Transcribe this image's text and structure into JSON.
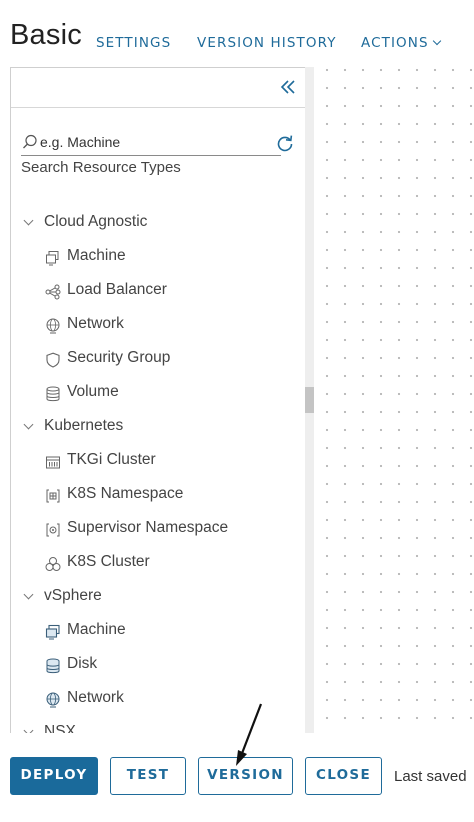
{
  "header": {
    "title": "Basic",
    "nav": {
      "settings": "SETTINGS",
      "version_history": "VERSION HISTORY",
      "actions": "ACTIONS"
    }
  },
  "sidebar": {
    "collapse_icon": "double-chevron-left-icon",
    "search": {
      "placeholder": "e.g. Machine",
      "label": "Search Resource Types"
    },
    "refresh_icon": "refresh-icon",
    "categories": [
      {
        "label": "Cloud Agnostic",
        "items": [
          {
            "label": "Machine",
            "icon": "machine-icon"
          },
          {
            "label": "Load Balancer",
            "icon": "load-balancer-icon"
          },
          {
            "label": "Network",
            "icon": "network-globe-icon"
          },
          {
            "label": "Security Group",
            "icon": "shield-icon"
          },
          {
            "label": "Volume",
            "icon": "database-icon"
          }
        ]
      },
      {
        "label": "Kubernetes",
        "items": [
          {
            "label": "TKGi Cluster",
            "icon": "tkgi-cluster-icon"
          },
          {
            "label": "K8S Namespace",
            "icon": "namespace-icon"
          },
          {
            "label": "Supervisor Namespace",
            "icon": "supervisor-namespace-icon"
          },
          {
            "label": "K8S Cluster",
            "icon": "cluster-icon"
          }
        ]
      },
      {
        "label": "vSphere",
        "items": [
          {
            "label": "Machine",
            "icon": "vsphere-machine-icon"
          },
          {
            "label": "Disk",
            "icon": "disk-icon"
          },
          {
            "label": "Network",
            "icon": "vsphere-network-icon"
          }
        ]
      },
      {
        "label": "NSX",
        "items": []
      }
    ]
  },
  "footer": {
    "deploy": "DEPLOY",
    "test": "TEST",
    "version": "VERSION",
    "close": "CLOSE",
    "status": "Last saved"
  },
  "colors": {
    "accent": "#1f6b9a",
    "primary_button": "#1a6a9b",
    "panel_border": "#cfcfcf"
  }
}
